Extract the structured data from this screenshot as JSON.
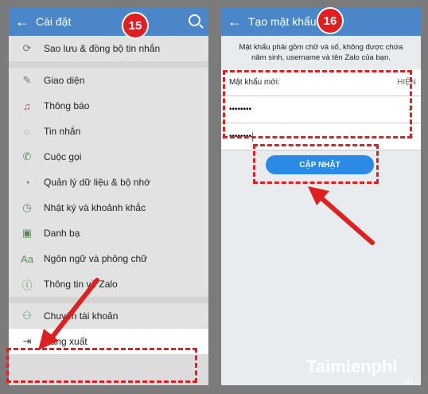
{
  "left": {
    "title": "Cài đặt",
    "badge": "15",
    "items": [
      {
        "label": "Sao lưu & đồng bộ tin nhắn",
        "icon": "backup-icon"
      },
      {
        "label": "Giao diện",
        "icon": "brush-icon"
      },
      {
        "label": "Thông báo",
        "icon": "bell-icon"
      },
      {
        "label": "Tin nhắn",
        "icon": "chat-icon"
      },
      {
        "label": "Cuộc gọi",
        "icon": "phone-icon"
      },
      {
        "label": "Quản lý dữ liệu & bộ nhớ",
        "icon": "pie-icon"
      },
      {
        "label": "Nhật ký và khoảnh khắc",
        "icon": "clock-icon"
      },
      {
        "label": "Danh bạ",
        "icon": "contacts-icon"
      },
      {
        "label": "Ngôn ngữ và phông chữ",
        "icon": "font-icon"
      },
      {
        "label": "Thông tin về Zalo",
        "icon": "info-icon"
      },
      {
        "label": "Chuyển tài khoản",
        "icon": "switch-account-icon"
      },
      {
        "label": "Đăng xuất",
        "icon": "logout-icon"
      }
    ]
  },
  "right": {
    "title": "Tạo mật khẩu",
    "badge": "16",
    "note": "Mật khẩu phải gồm chữ và số, không được chứa năm sinh, username và tên Zalo của bạn.",
    "new_label": "Mật khẩu mới:",
    "show": "HIỆN",
    "pw1": "••••••••",
    "pw2": "••••••••",
    "button": "CẬP NHẬT"
  },
  "watermark": {
    "brand": "Taimienphi",
    "suffix": ".vn"
  },
  "colors": {
    "accent": "#4a86c8",
    "highlight": "#e02020",
    "button": "#2a8ae6"
  }
}
